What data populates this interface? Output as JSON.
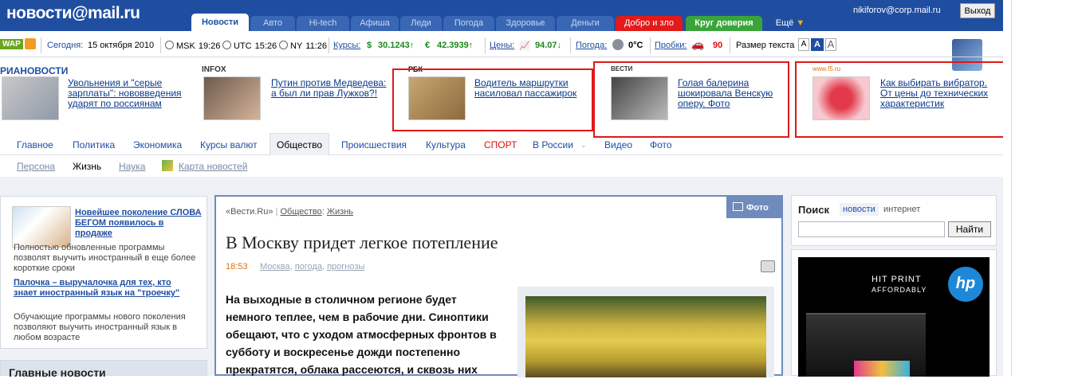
{
  "header": {
    "logo": "новости@mail.ru",
    "tabs": [
      "Новости",
      "Авто",
      "Hi-tech",
      "Афиша",
      "Леди",
      "Погода",
      "Здоровье",
      "Деньги",
      "Добро и зло",
      "Круг доверия",
      "Ещё"
    ],
    "user_email": "nikiforov@corp.mail.ru",
    "logout_label": "Выход"
  },
  "ticker": {
    "wap": "WAP",
    "today_label": "Сегодня:",
    "date": "15 октября 2010",
    "msk": "MSK",
    "msk_time": "19:26",
    "utc": "UTC",
    "utc_time": "15:26",
    "ny": "NY",
    "ny_time": "11:26",
    "rates_label": "Курсы:",
    "usd": "30.1243↑",
    "eur": "42.3939↑",
    "prices_label": "Цены:",
    "price": "94.07↓",
    "weather_label": "Погода:",
    "temp": "0°C",
    "traffic_label": "Пробки:",
    "traffic": "90",
    "text_size_label": "Размер текста",
    "sizes": [
      "A",
      "A",
      "A"
    ]
  },
  "promo": [
    {
      "source": "РИАНОВОСТИ",
      "text": "Увольнения и \"серые зарплаты\": нововведения ударят по россиянам"
    },
    {
      "source": "INFOX",
      "text": "Путин против Медведева: а был ли прав Лужков?!"
    },
    {
      "source": "РБК",
      "text": "Водитель маршрутки насиловал пассажирок"
    },
    {
      "source": "ВЕСТИ",
      "text": "Голая балерина шокировала Венскую оперу. Фото"
    },
    {
      "source": "www.f5.ru",
      "text": "Как выбирать вибратор. От цены до технических характеристик"
    }
  ],
  "nav": [
    "Главное",
    "Политика",
    "Экономика",
    "Курсы валют",
    "Общество",
    "Происшествия",
    "Культура",
    "СПОРТ",
    "В России",
    "Видео",
    "Фото"
  ],
  "subnav": [
    "Персона",
    "Жизнь",
    "Наука",
    "Карта новостей"
  ],
  "left": {
    "item1_title": "Новейшее поколение СЛОВА БЕГОМ появилось в продаже",
    "item1_text": "Полностью обновленные программы позволят выучить иностранный в еще более короткие сроки",
    "item2_title": "Палочка – выручалочка для тех, кто знает иностранный язык на \"троечку\"",
    "item2_text": "Обучающие программы нового поколения позволяют выучить иностранный язык в любом возрасте",
    "main_news": "Главные новости"
  },
  "article": {
    "source": "«Вести.Ru»",
    "section1": "Общество",
    "section2": "Жизнь",
    "photo_badge": "Фото",
    "title": "В Москву придет легкое потепление",
    "time": "18:53",
    "tags": [
      "Москва",
      "погода",
      "прогнозы"
    ],
    "body": "На выходные в столичном регионе будет немного теплее, чем в рабочие дни. Синоптики обещают, что с уходом атмосферных фронтов в субботу и воскресенье дожди постепенно прекратятся, облака рассеются, и сквозь них"
  },
  "search": {
    "title": "Поиск",
    "opt1": "новости",
    "opt2": "интернет",
    "button": "Найти"
  },
  "ad": {
    "line1": "HIT PRINT",
    "line2": "AFFORDABLY",
    "brand": "hp"
  }
}
